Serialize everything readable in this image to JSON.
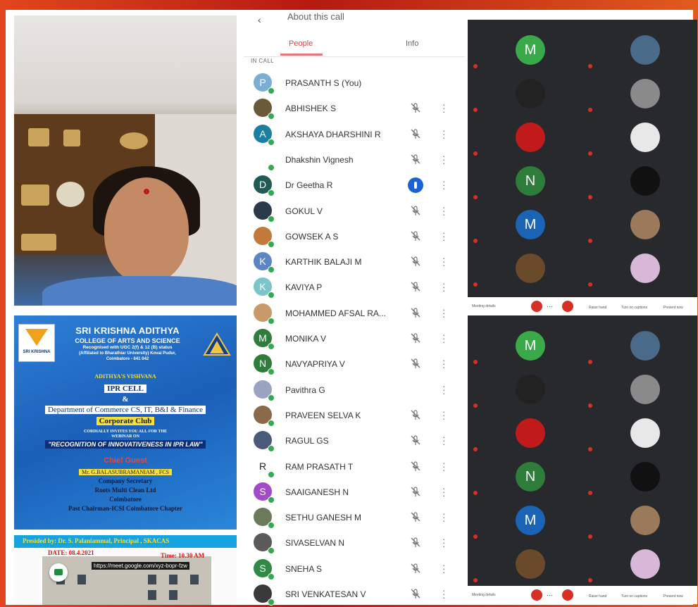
{
  "panel": {
    "header": "About this call",
    "tabs": [
      "People",
      "Info"
    ],
    "section": "IN CALL",
    "participants": [
      {
        "name": "PRASANTH S (You)",
        "avatar": "P",
        "color": "#7aaed4",
        "muted": false,
        "speaking": false,
        "more": false
      },
      {
        "name": "ABHISHEK S",
        "avatar": "",
        "color": "#6a5a3a",
        "muted": true,
        "speaking": false,
        "more": true
      },
      {
        "name": "AKSHAYA DHARSHINI R",
        "avatar": "A",
        "color": "#1a7fa0",
        "muted": true,
        "speaking": false,
        "more": true
      },
      {
        "name": "Dhakshin Vignesh",
        "avatar": "",
        "color": "#ffffff",
        "muted": true,
        "speaking": false,
        "more": true
      },
      {
        "name": "Dr Geetha R",
        "avatar": "D",
        "color": "#1f5a56",
        "muted": false,
        "speaking": true,
        "more": true
      },
      {
        "name": "GOKUL V",
        "avatar": "",
        "color": "#2a3a4a",
        "muted": true,
        "speaking": false,
        "more": true
      },
      {
        "name": "GOWSEK A S",
        "avatar": "",
        "color": "#c07a3a",
        "muted": true,
        "speaking": false,
        "more": true
      },
      {
        "name": "KARTHIK BALAJI M",
        "avatar": "K",
        "color": "#5b86c4",
        "muted": true,
        "speaking": false,
        "more": true
      },
      {
        "name": "KAVIYA P",
        "avatar": "K",
        "color": "#7cc4cc",
        "muted": true,
        "speaking": false,
        "more": true
      },
      {
        "name": "MOHAMMED AFSAL RA...",
        "avatar": "",
        "color": "#c89a6a",
        "muted": true,
        "speaking": false,
        "more": true
      },
      {
        "name": "MONIKA V",
        "avatar": "M",
        "color": "#2e7d3a",
        "muted": true,
        "speaking": false,
        "more": true
      },
      {
        "name": "NAVYAPRIYA V",
        "avatar": "N",
        "color": "#2e7d3a",
        "muted": true,
        "speaking": false,
        "more": true
      },
      {
        "name": "Pavithra G",
        "avatar": "",
        "color": "#9aa4c2",
        "muted": false,
        "speaking": false,
        "more": true
      },
      {
        "name": "PRAVEEN SELVA K",
        "avatar": "",
        "color": "#8a6a4a",
        "muted": true,
        "speaking": false,
        "more": true
      },
      {
        "name": "RAGUL GS",
        "avatar": "",
        "color": "#4a5a7a",
        "muted": true,
        "speaking": false,
        "more": true
      },
      {
        "name": "RAM PRASATH T",
        "avatar": "R",
        "color": "#ffffff",
        "muted": true,
        "speaking": false,
        "more": true
      },
      {
        "name": "SAAIGANESH N",
        "avatar": "S",
        "color": "#a24ac8",
        "muted": true,
        "speaking": false,
        "more": true
      },
      {
        "name": "SETHU GANESH M",
        "avatar": "",
        "color": "#6a7a5a",
        "muted": true,
        "speaking": false,
        "more": true
      },
      {
        "name": "SIVASELVAN N",
        "avatar": "",
        "color": "#5a5a5a",
        "muted": true,
        "speaking": false,
        "more": true
      },
      {
        "name": "SNEHA S",
        "avatar": "S",
        "color": "#2e8a44",
        "muted": true,
        "speaking": false,
        "more": true
      },
      {
        "name": "SRI VENKATESAN V",
        "avatar": "",
        "color": "#3a3a3a",
        "muted": true,
        "speaking": false,
        "more": true
      }
    ]
  },
  "poster": {
    "college": "SRI KRISHNA ADITHYA",
    "subtitle": "COLLEGE OF ARTS AND SCIENCE",
    "recognition": "Recognised with UGC 2(f) & 12 (B) status",
    "affiliation": "(Affiliated to Bharathiar University) Kovai Pudur,",
    "city": "Coimbatore - 641 042",
    "vision": "ADITHYA'S VISHVANA",
    "cell": "IPR CELL",
    "amp": "&",
    "dept": "Department of Commerce CS, IT, B&I & Finance",
    "club": "Corporate Club",
    "invite": "CORDIALLY INVITES YOU ALL FOR THE",
    "webinar": "WEBINAR ON",
    "topic": "\"RECOGNITION OF INNOVATIVENESS IN IPR LAW\"",
    "chief_label": "Chief Guest",
    "guest": "Mr. G.BALASUBRAMANIAM , FCS",
    "role": "Company Secretary",
    "company": "Roots Multi Clean Ltd",
    "location": "Coimbatore",
    "past": "Past Chairman-ICSI Coimbatore Chapter",
    "logo_text": "SRI KRISHNA",
    "presided": "Presided by: Dr. S. Palaniammal, Principal , SKACAS",
    "date": "DATE: 08.4.2021",
    "time": "Time: 10.30 AM",
    "link": "https://meet.google.com/xyz-bopr-fzw"
  },
  "grid": {
    "tiles": [
      {
        "avatar": "M",
        "color": "#3aa94a"
      },
      {
        "avatar": "",
        "color": "#4a6a8a"
      },
      {
        "avatar": "",
        "color": "#222222"
      },
      {
        "avatar": "",
        "color": "#8a8a8a"
      },
      {
        "avatar": "",
        "color": "#c01a1a"
      },
      {
        "avatar": "",
        "color": "#e8e8e8"
      },
      {
        "avatar": "N",
        "color": "#2e7d3a"
      },
      {
        "avatar": "",
        "color": "#111111"
      },
      {
        "avatar": "M",
        "color": "#1a63b5"
      },
      {
        "avatar": "",
        "color": "#9a7a5a"
      },
      {
        "avatar": "",
        "color": "#6a4a2a"
      },
      {
        "avatar": "",
        "color": "#d8b8d8"
      }
    ],
    "controls": {
      "meeting": "Meeting details",
      "raise": "Raise hand",
      "captions": "Turn on captions",
      "present": "Present now"
    }
  }
}
